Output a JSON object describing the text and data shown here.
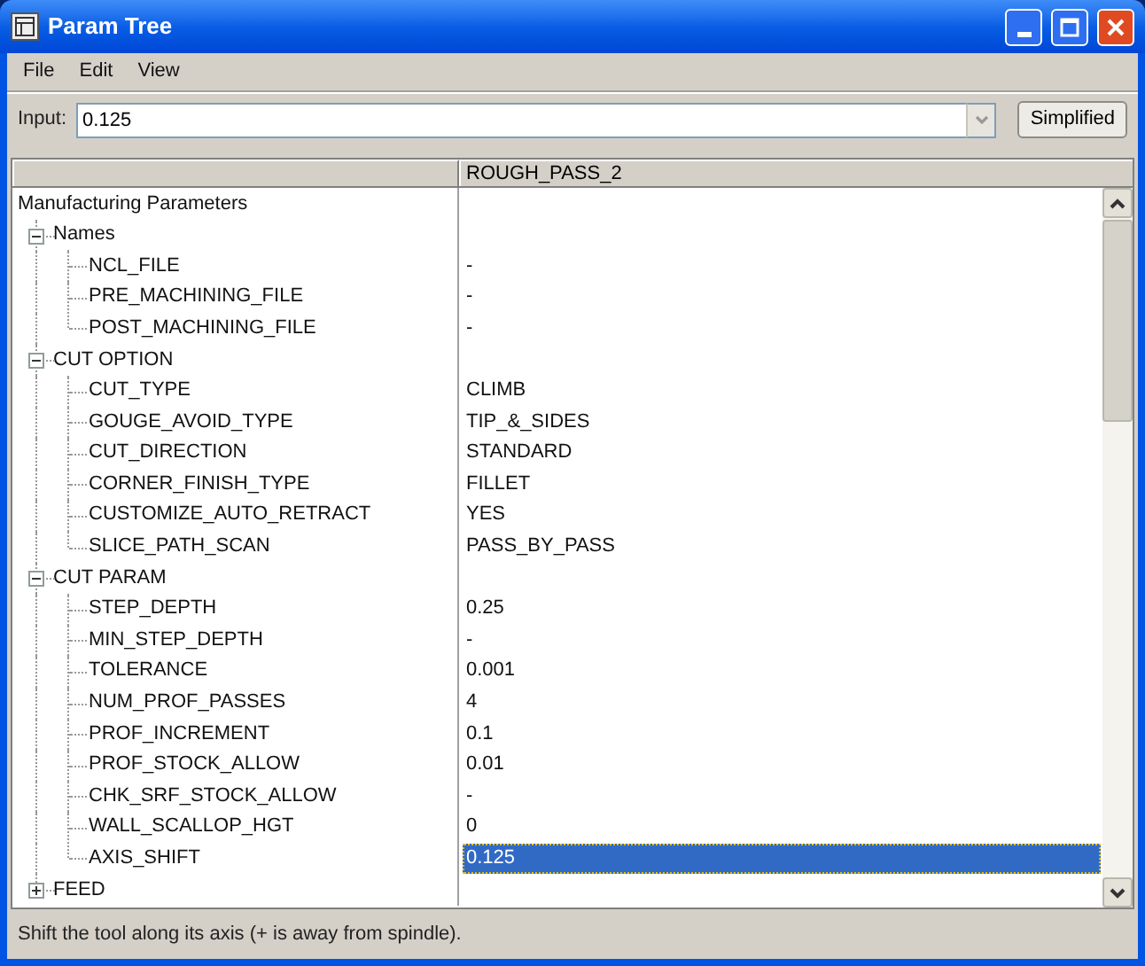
{
  "window": {
    "title": "Param Tree"
  },
  "menu": [
    "File",
    "Edit",
    "View"
  ],
  "input": {
    "label": "Input:",
    "value": "0.125"
  },
  "mode_button": "Simplified",
  "table": {
    "header": "ROUGH_PASS_2",
    "root": "Manufacturing Parameters",
    "groups": [
      {
        "label": "Names",
        "expanded": true,
        "children": [
          {
            "name": "NCL_FILE",
            "value": "-",
            "selected": false
          },
          {
            "name": "PRE_MACHINING_FILE",
            "value": "-",
            "selected": false
          },
          {
            "name": "POST_MACHINING_FILE",
            "value": "-",
            "selected": false
          }
        ]
      },
      {
        "label": "CUT OPTION",
        "expanded": true,
        "children": [
          {
            "name": "CUT_TYPE",
            "value": "CLIMB",
            "selected": false
          },
          {
            "name": "GOUGE_AVOID_TYPE",
            "value": "TIP_&_SIDES",
            "selected": false
          },
          {
            "name": "CUT_DIRECTION",
            "value": "STANDARD",
            "selected": false
          },
          {
            "name": "CORNER_FINISH_TYPE",
            "value": "FILLET",
            "selected": false
          },
          {
            "name": "CUSTOMIZE_AUTO_RETRACT",
            "value": "YES",
            "selected": false
          },
          {
            "name": "SLICE_PATH_SCAN",
            "value": "PASS_BY_PASS",
            "selected": false
          }
        ]
      },
      {
        "label": "CUT PARAM",
        "expanded": true,
        "children": [
          {
            "name": "STEP_DEPTH",
            "value": "0.25",
            "selected": false
          },
          {
            "name": "MIN_STEP_DEPTH",
            "value": "-",
            "selected": false
          },
          {
            "name": "TOLERANCE",
            "value": "0.001",
            "selected": false
          },
          {
            "name": "NUM_PROF_PASSES",
            "value": "4",
            "selected": false
          },
          {
            "name": "PROF_INCREMENT",
            "value": "0.1",
            "selected": false
          },
          {
            "name": "PROF_STOCK_ALLOW",
            "value": "0.01",
            "selected": false
          },
          {
            "name": "CHK_SRF_STOCK_ALLOW",
            "value": "-",
            "selected": false
          },
          {
            "name": "WALL_SCALLOP_HGT",
            "value": "0",
            "selected": false
          },
          {
            "name": "AXIS_SHIFT",
            "value": "0.125",
            "selected": true
          }
        ]
      },
      {
        "label": "FEED",
        "expanded": false
      }
    ]
  },
  "status_bar": "Shift the tool along its axis (+ is away from spindle)."
}
